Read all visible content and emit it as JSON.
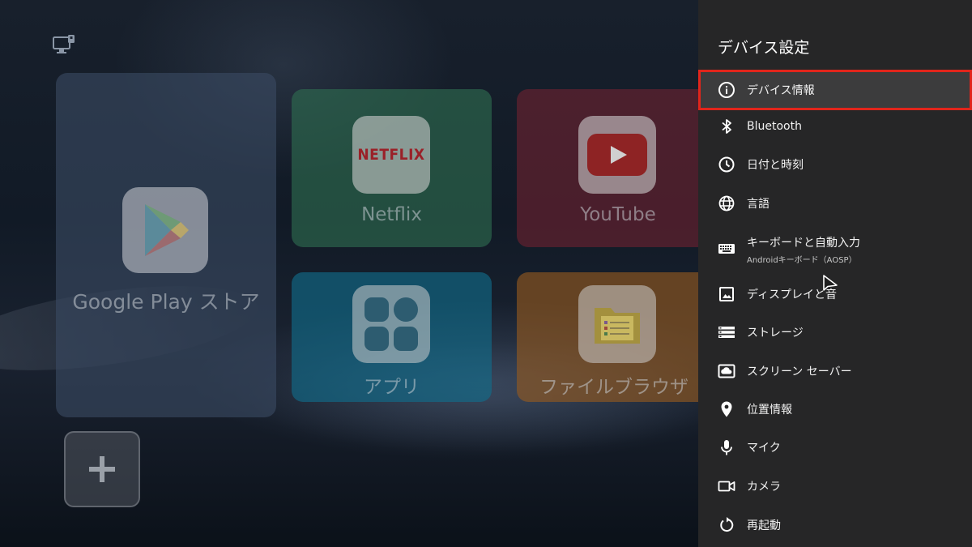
{
  "home": {
    "tiles": [
      {
        "label": "Google Play ストア"
      },
      {
        "label": "Netflix",
        "logo": "NETFLIX"
      },
      {
        "label": "YouTube"
      },
      {
        "label": "アプリ"
      },
      {
        "label": "ファイルブラウザ"
      }
    ],
    "add_button_icon": "plus-icon",
    "top_icon": "input-source-icon"
  },
  "settings": {
    "title": "デバイス設定",
    "items": [
      {
        "label": "デバイス情報",
        "icon": "info-icon",
        "selected": true
      },
      {
        "label": "Bluetooth",
        "icon": "bluetooth-icon"
      },
      {
        "label": "日付と時刻",
        "icon": "clock-icon"
      },
      {
        "label": "言語",
        "icon": "globe-icon"
      },
      {
        "label": "キーボードと自動入力",
        "sublabel": "Androidキーボード（AOSP）",
        "icon": "keyboard-icon"
      },
      {
        "label": "ディスプレイと音",
        "icon": "image-icon"
      },
      {
        "label": "ストレージ",
        "icon": "storage-icon"
      },
      {
        "label": "スクリーン セーバー",
        "icon": "screensaver-icon"
      },
      {
        "label": "位置情報",
        "icon": "location-icon"
      },
      {
        "label": "マイク",
        "icon": "mic-icon"
      },
      {
        "label": "カメラ",
        "icon": "camera-icon"
      },
      {
        "label": "再起動",
        "icon": "restart-icon"
      }
    ]
  },
  "colors": {
    "panel_bg": "#262627",
    "selection_outline": "#e1251b",
    "netflix_red": "#b81d24",
    "youtube_red": "#c4302b"
  }
}
